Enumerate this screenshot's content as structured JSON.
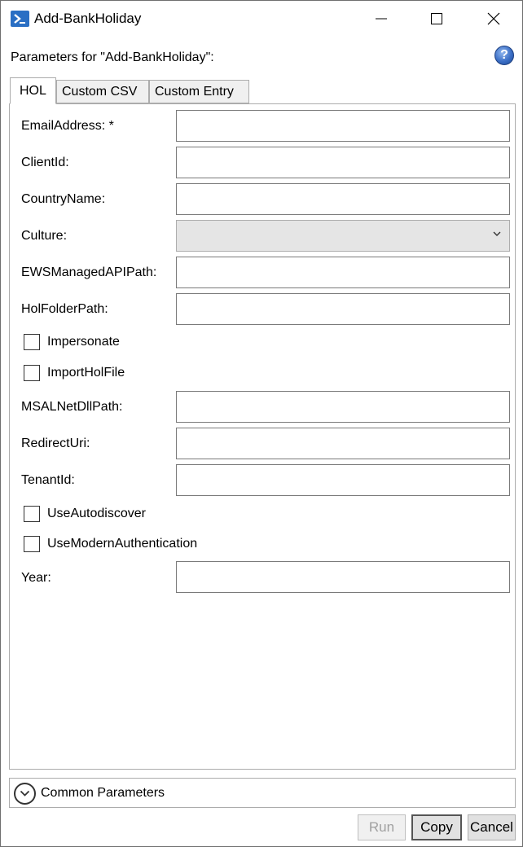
{
  "window": {
    "title": "Add-BankHoliday"
  },
  "heading": "Parameters for \"Add-BankHoliday\":",
  "help_glyph": "?",
  "tabs": [
    {
      "label": "HOL",
      "active": true
    },
    {
      "label": "Custom CSV",
      "active": false
    },
    {
      "label": "Custom Entry",
      "active": false
    }
  ],
  "fields": {
    "email_address": {
      "label": "EmailAddress: *",
      "value": ""
    },
    "client_id": {
      "label": "ClientId:",
      "value": ""
    },
    "country_name": {
      "label": "CountryName:",
      "value": ""
    },
    "culture": {
      "label": "Culture:",
      "value": ""
    },
    "ews_path": {
      "label": "EWSManagedAPIPath:",
      "value": ""
    },
    "hol_folder_path": {
      "label": "HolFolderPath:",
      "value": ""
    },
    "impersonate": {
      "label": "Impersonate",
      "checked": false
    },
    "import_hol_file": {
      "label": "ImportHolFile",
      "checked": false
    },
    "msal_path": {
      "label": "MSALNetDllPath:",
      "value": ""
    },
    "redirect_uri": {
      "label": "RedirectUri:",
      "value": ""
    },
    "tenant_id": {
      "label": "TenantId:",
      "value": ""
    },
    "use_autodiscover": {
      "label": "UseAutodiscover",
      "checked": false
    },
    "use_modern_auth": {
      "label": "UseModernAuthentication",
      "checked": false
    },
    "year": {
      "label": "Year:",
      "value": ""
    }
  },
  "common_parameters": {
    "label": "Common Parameters"
  },
  "buttons": {
    "run": "Run",
    "copy": "Copy",
    "cancel": "Cancel"
  },
  "colors": {
    "icon_blue": "#2a6fc4",
    "disabled_text": "#a0a0a0",
    "tab_inactive_bg": "#f0f0f0"
  }
}
